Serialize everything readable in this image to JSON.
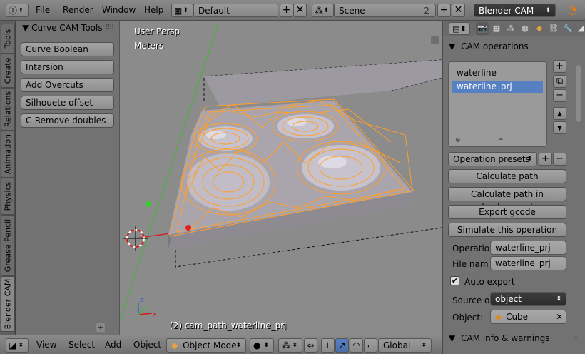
{
  "header": {
    "menus": [
      "File",
      "Render",
      "Window",
      "Help"
    ],
    "layout": "Default",
    "scene": "Scene",
    "scene_users": "2",
    "engine": "Blender CAM"
  },
  "left_tabs": [
    "Tools",
    "Create",
    "Relations",
    "Animation",
    "Physics",
    "Grease Pencil",
    "Blender CAM"
  ],
  "tool_shelf": {
    "panel_title": "Curve CAM Tools",
    "buttons": [
      "Curve Boolean",
      "Intarsion",
      "Add Overcuts",
      "Silhouete offset",
      "C-Remove doubles"
    ]
  },
  "viewport": {
    "view_name": "User Persp",
    "units": "Meters",
    "object_info": "(2) cam_path_waterline_prj",
    "colors": {
      "background": "#8b8b8b",
      "toolpath": "#ff9f2a",
      "x_axis": "#d21a1a",
      "y_axis": "#46b33a"
    }
  },
  "properties": {
    "section_operations": "CAM operations",
    "operations": [
      "waterline",
      "waterline_prj"
    ],
    "selected_operation": "waterline_prj",
    "operation_presets": "Operation presets",
    "buttons": [
      "Calculate path",
      "Calculate path in background",
      "Export gcode",
      "Simulate this operation"
    ],
    "operation_label": "Operatio",
    "operation_value": "waterline_prj",
    "filename_label": "File nam",
    "filename_value": "waterline_prj",
    "auto_export_label": "Auto export",
    "source_label": "Source o",
    "source_value": "object",
    "object_label": "Object:",
    "object_value": "Cube",
    "section_info": "CAM info & warnings",
    "accent": "#5680c2"
  },
  "footer": {
    "menus": [
      "View",
      "Select",
      "Add",
      "Object"
    ],
    "mode": "Object Mode",
    "orientation": "Global"
  }
}
